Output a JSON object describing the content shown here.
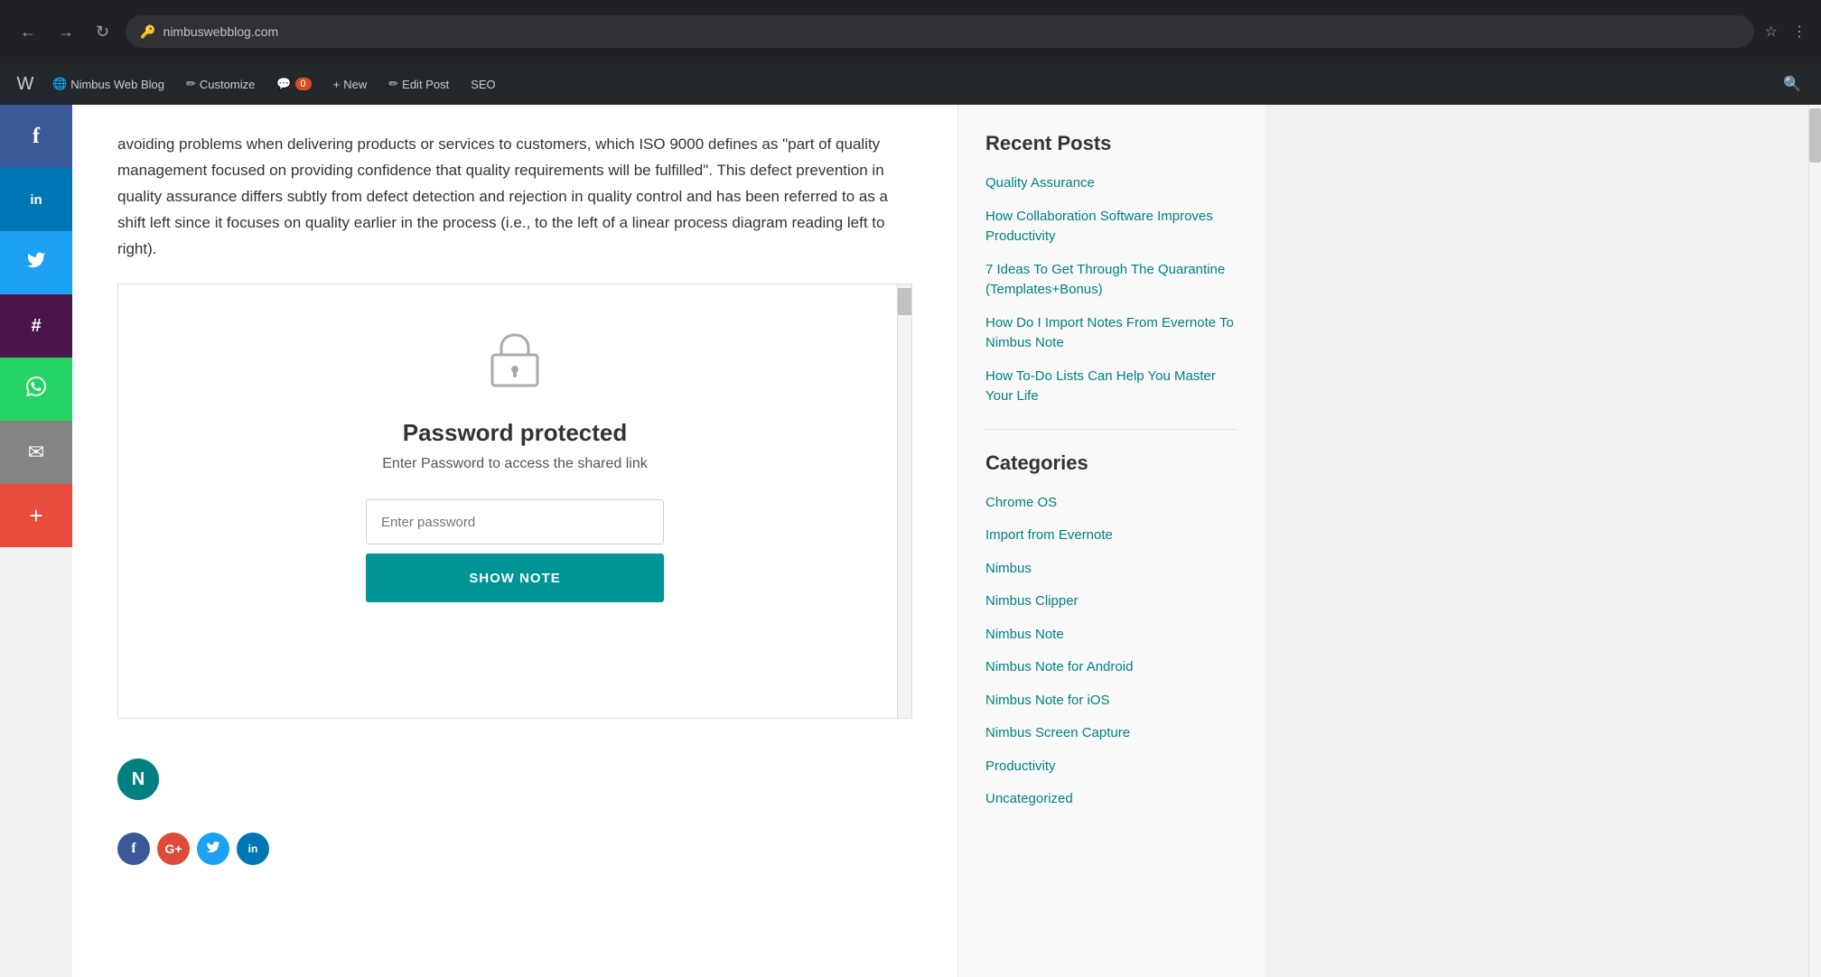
{
  "browser": {
    "back_btn": "←",
    "forward_btn": "→",
    "refresh_btn": "↻",
    "address_text": "nimbuswebblog.com",
    "key_icon": "🔑",
    "star_icon": "☆",
    "more_icon": "⋮"
  },
  "wp_admin_bar": {
    "wp_logo": "W",
    "site_name": "Nimbus Web Blog",
    "customize_label": "Customize",
    "comments_label": "0",
    "new_label": "New",
    "edit_post_label": "Edit Post",
    "seo_label": "SEO"
  },
  "social_sidebar": {
    "facebook": "f",
    "linkedin": "in",
    "twitter": "t",
    "slack": "#",
    "whatsapp": "w",
    "email": "✉",
    "plus": "+"
  },
  "article": {
    "text": "avoiding problems when delivering products or services to customers, which ISO 9000 defines as \"part of quality management focused on providing confidence that quality requirements will be fulfilled\". This defect prevention in quality assurance differs subtly from defect detection and rejection in quality control and has been referred to as a shift left since it focuses on quality earlier in the process (i.e., to the left of a linear process diagram reading left to right)."
  },
  "password_box": {
    "lock_symbol": "🔒",
    "title": "Password protected",
    "subtitle": "Enter Password to access the shared link",
    "input_placeholder": "Enter password",
    "button_label": "SHOW NOTE",
    "nimbus_initial": "N"
  },
  "post_social": {
    "facebook": "f",
    "google": "G",
    "twitter": "t",
    "linkedin": "in"
  },
  "right_sidebar": {
    "recent_posts_title": "Recent Posts",
    "recent_posts": [
      {
        "label": "Quality Assurance"
      },
      {
        "label": "How Collaboration Software Improves Productivity"
      },
      {
        "label": "7 Ideas To Get Through The Quarantine (Templates+Bonus)"
      },
      {
        "label": "How Do I Import Notes From Evernote To Nimbus Note"
      },
      {
        "label": "How To-Do Lists Can Help You Master Your Life"
      }
    ],
    "categories_title": "Categories",
    "categories": [
      {
        "label": "Chrome OS"
      },
      {
        "label": "Import from Evernote"
      },
      {
        "label": "Nimbus"
      },
      {
        "label": "Nimbus Clipper"
      },
      {
        "label": "Nimbus Note"
      },
      {
        "label": "Nimbus Note for Android"
      },
      {
        "label": "Nimbus Note for iOS"
      },
      {
        "label": "Nimbus Screen Capture"
      },
      {
        "label": "Productivity"
      },
      {
        "label": "Uncategorized"
      }
    ]
  }
}
